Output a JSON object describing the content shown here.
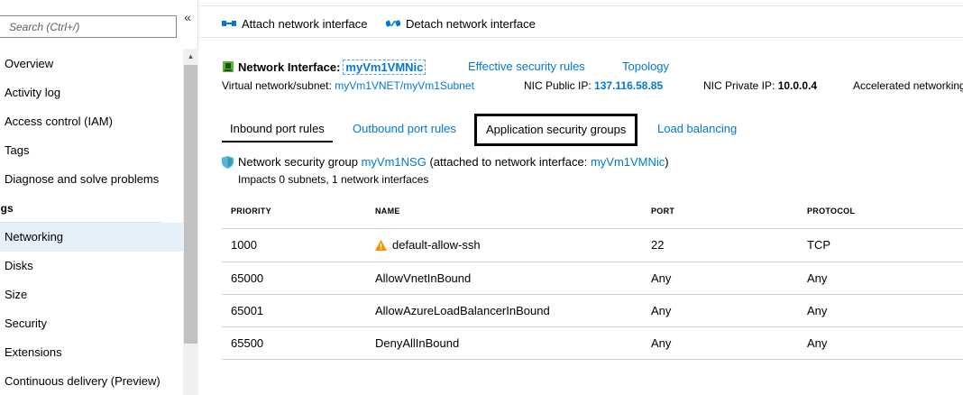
{
  "sidebar": {
    "search_placeholder": "Search (Ctrl+/)",
    "collapse_glyph": "«",
    "items": [
      {
        "label": "Overview"
      },
      {
        "label": "Activity log"
      },
      {
        "label": "Access control (IAM)"
      },
      {
        "label": "Tags"
      },
      {
        "label": "Diagnose and solve problems"
      }
    ],
    "section_label": "ings",
    "settings_items": [
      {
        "label": "Networking",
        "active": true
      },
      {
        "label": "Disks"
      },
      {
        "label": "Size"
      },
      {
        "label": "Security"
      },
      {
        "label": "Extensions"
      },
      {
        "label": "Continuous delivery (Preview)"
      }
    ]
  },
  "toolbar": {
    "attach_label": "Attach network interface",
    "detach_label": "Detach network interface",
    "attach_icon": "attach-network-icon",
    "detach_icon": "detach-network-icon"
  },
  "nic": {
    "label": "Network Interface:",
    "name": "myVm1VMNic",
    "effective_rules_link": "Effective security rules",
    "topology_link": "Topology",
    "vnet_label": "Virtual network/subnet:",
    "vnet_value": "myVm1VNET/myVm1Subnet",
    "public_ip_label": "NIC Public IP:",
    "public_ip_value": "137.116.58.85",
    "private_ip_label": "NIC Private IP:",
    "private_ip_value": "10.0.0.4",
    "accelerated_label": "Accelerated networking"
  },
  "tabs": {
    "inbound": "Inbound port rules",
    "outbound": "Outbound port rules",
    "asg": "Application security groups",
    "lb": "Load balancing"
  },
  "nsg": {
    "prefix": "Network security group",
    "name": "myVm1NSG",
    "attached_prefix": "(attached to network interface:",
    "attached_nic": "myVm1VMNic",
    "attached_suffix": ")",
    "impacts": "Impacts 0 subnets, 1 network interfaces"
  },
  "rules": {
    "headers": {
      "priority": "PRIORITY",
      "name": "NAME",
      "port": "PORT",
      "protocol": "PROTOCOL"
    },
    "rows": [
      {
        "priority": "1000",
        "name": "default-allow-ssh",
        "port": "22",
        "protocol": "TCP",
        "warning": true
      },
      {
        "priority": "65000",
        "name": "AllowVnetInBound",
        "port": "Any",
        "protocol": "Any"
      },
      {
        "priority": "65001",
        "name": "AllowAzureLoadBalancerInBound",
        "port": "Any",
        "protocol": "Any"
      },
      {
        "priority": "65500",
        "name": "DenyAllInBound",
        "port": "Any",
        "protocol": "Any"
      }
    ]
  },
  "colors": {
    "link_blue": "#0078d4",
    "active_nav_bg": "#e6f0fa",
    "warning_orange": "#ff8c00",
    "nic_icon_green": "#5bb432"
  }
}
